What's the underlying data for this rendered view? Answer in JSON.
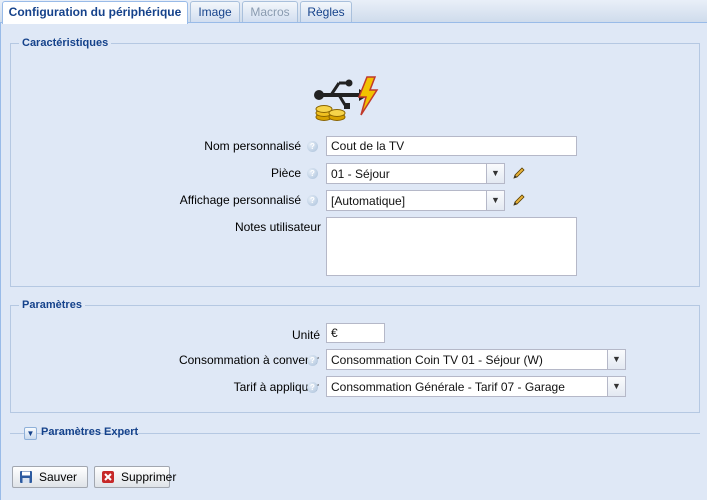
{
  "tabs": [
    {
      "label": "Configuration du périphérique",
      "state": "active"
    },
    {
      "label": "Image",
      "state": "normal"
    },
    {
      "label": "Macros",
      "state": "disabled"
    },
    {
      "label": "Règles",
      "state": "normal"
    }
  ],
  "characteristics": {
    "legend": "Caractéristiques",
    "device_icon": "usb-energy-icon",
    "name_label": "Nom personnalisé",
    "name_value": "Cout de la TV",
    "room_label": "Pièce",
    "room_value": "01 - Séjour",
    "display_label": "Affichage personnalisé",
    "display_value": "[Automatique]",
    "notes_label": "Notes utilisateur",
    "notes_value": ""
  },
  "parameters": {
    "legend": "Paramètres",
    "unit_label": "Unité",
    "unit_value": "€",
    "consumption_label": "Consommation à convertir",
    "consumption_value": "Consommation Coin TV 01 - Séjour (W)",
    "tariff_label": "Tarif à appliquer",
    "tariff_value": "Consommation Générale - Tarif 07 - Garage"
  },
  "expert": {
    "label": "Paramètres Expert"
  },
  "buttons": {
    "save": "Sauver",
    "delete": "Supprimer"
  },
  "colors": {
    "accent": "#15428b",
    "panel": "#dfe8f6"
  }
}
